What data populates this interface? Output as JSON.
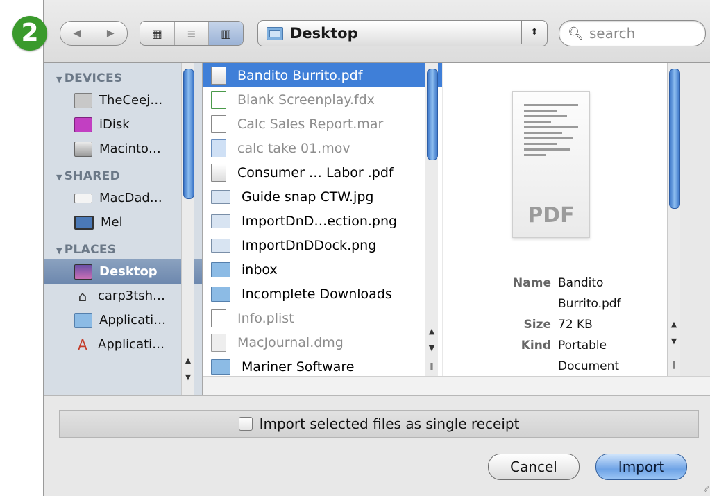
{
  "step_badge": "2",
  "toolbar": {
    "back_glyph": "◀",
    "forward_glyph": "▶",
    "view_icon_glyph": "▦",
    "view_list_glyph": "≣",
    "view_columns_glyph": "▥",
    "location": "Desktop",
    "popup_arrows_glyph": "⬍",
    "search_placeholder": "search"
  },
  "sidebar": {
    "devices_header": "DEVICES",
    "devices": [
      "TheCeej…",
      "iDisk",
      "Macinto…"
    ],
    "shared_header": "SHARED",
    "shared": [
      "MacDad…",
      "Mel"
    ],
    "places_header": "PLACES",
    "places": [
      "Desktop",
      "carp3tsh…",
      "Applicati…",
      "Applicati…"
    ],
    "selected": "Desktop"
  },
  "files": [
    {
      "name": "Bandito Burrito.pdf",
      "state": "selected",
      "icon": "pdf-icon"
    },
    {
      "name": "Blank Screenplay.fdx",
      "state": "dimmed",
      "icon": "fdx-icon"
    },
    {
      "name": "Calc Sales Report.mar",
      "state": "dimmed",
      "icon": "document-icon"
    },
    {
      "name": "calc take 01.mov",
      "state": "dimmed",
      "icon": "movie-icon"
    },
    {
      "name": "Consumer … Labor .pdf",
      "state": "normal",
      "icon": "pdf-icon"
    },
    {
      "name": "Guide snap CTW.jpg",
      "state": "normal",
      "icon": "image-icon"
    },
    {
      "name": "ImportDnD…ection.png",
      "state": "normal",
      "icon": "image-icon"
    },
    {
      "name": "ImportDnDDock.png",
      "state": "normal",
      "icon": "image-icon"
    },
    {
      "name": "inbox",
      "state": "normal",
      "icon": "folder-icon",
      "folder": true
    },
    {
      "name": "Incomplete Downloads",
      "state": "normal",
      "icon": "folder-icon",
      "folder": true
    },
    {
      "name": "Info.plist",
      "state": "dimmed",
      "icon": "document-icon"
    },
    {
      "name": "MacJournal.dmg",
      "state": "dimmed",
      "icon": "disk-image-icon"
    },
    {
      "name": "Mariner Software",
      "state": "normal",
      "icon": "folder-icon",
      "folder": true
    }
  ],
  "preview": {
    "doc_label": "PDF",
    "name_label": "Name",
    "name_value_1": "Bandito",
    "name_value_2": "Burrito.pdf",
    "size_label": "Size",
    "size_value": "72 KB",
    "kind_label": "Kind",
    "kind_value_1": "Portable",
    "kind_value_2": "Document"
  },
  "option_label": "Import selected files as single receipt",
  "buttons": {
    "cancel": "Cancel",
    "import": "Import"
  }
}
